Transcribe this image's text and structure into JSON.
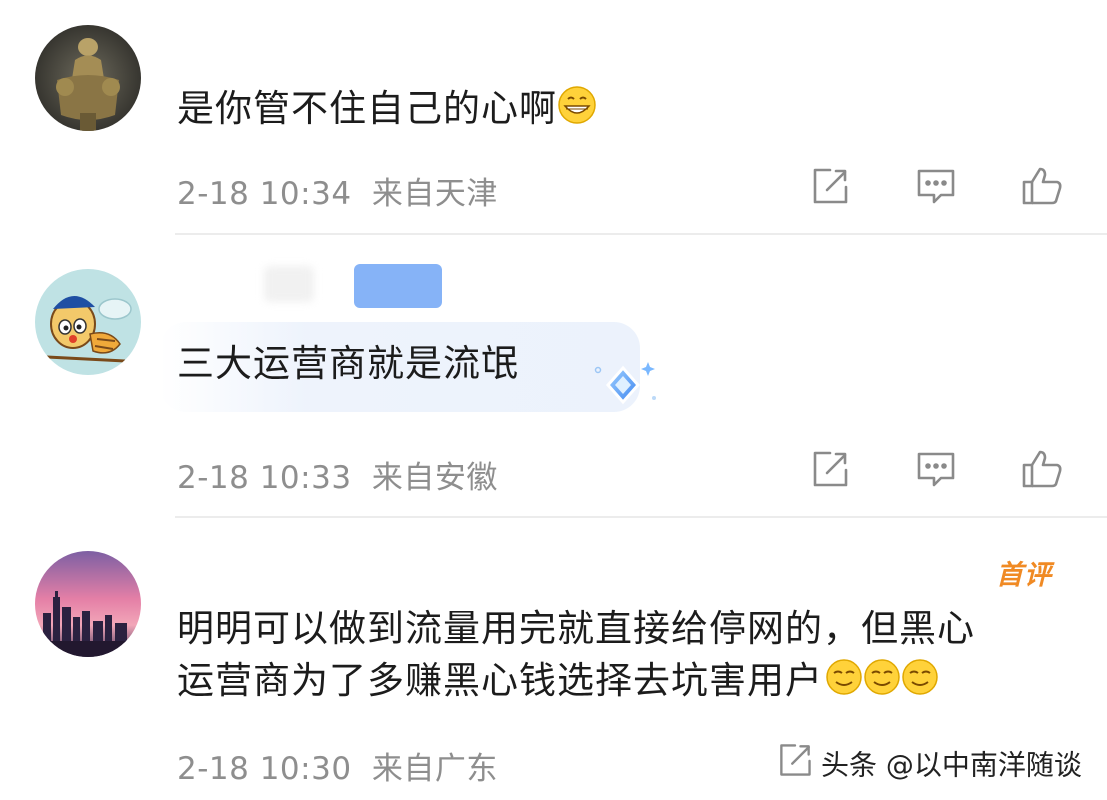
{
  "comments": [
    {
      "text": "是你管不住自己的心啊",
      "time": "2-18 10:34",
      "location": "来自天津",
      "emoji_count": 1
    },
    {
      "text": "三大运营商就是流氓",
      "time": "2-18 10:33",
      "location": "来自安徽",
      "emoji_count": 0
    },
    {
      "badge": "首评",
      "text_line1": "明明可以做到流量用完就直接给停网的，但黑心",
      "text_line2": "运营商为了多赚黑心钱选择去坑害用户",
      "time": "2-18 10:30",
      "location": "来自广东",
      "emoji_count": 3
    }
  ],
  "watermark": {
    "text": "头条 @以中南洋随谈"
  },
  "colors": {
    "meta_text": "#8e8e8e",
    "icon_stroke": "#8a8a8a",
    "badge": "#f08a24",
    "divider": "#ececec"
  },
  "icons": [
    "forward-icon",
    "comment-icon",
    "like-icon"
  ]
}
